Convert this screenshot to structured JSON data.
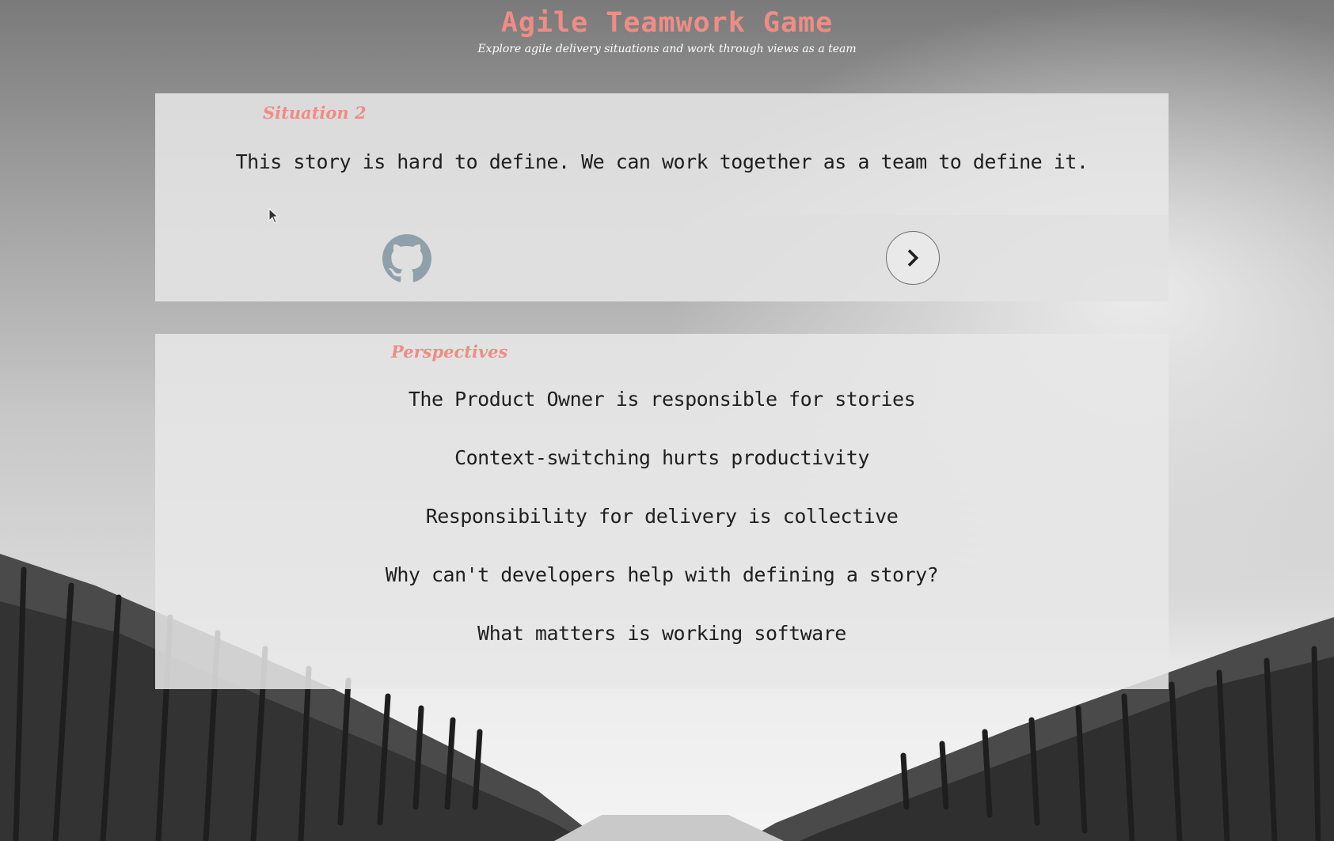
{
  "header": {
    "title": "Agile Teamwork Game",
    "subtitle": "Explore agile delivery situations and work through views as a team"
  },
  "situation": {
    "label": "Situation 2",
    "text": "This story is hard to define. We can work together as a team to define it."
  },
  "controls": {
    "github_icon": "github-icon",
    "next_icon": "chevron-right-icon"
  },
  "perspectives": {
    "label": "Perspectives",
    "items": [
      "The Product Owner is responsible for stories",
      "Context-switching hurts productivity",
      "Responsibility for delivery is collective",
      "Why can't developers help with defining a story?",
      "What matters is working software"
    ]
  },
  "colors": {
    "accent": "#ee8d85",
    "text": "#1f1f1f",
    "panel": "#e8e8e8"
  }
}
